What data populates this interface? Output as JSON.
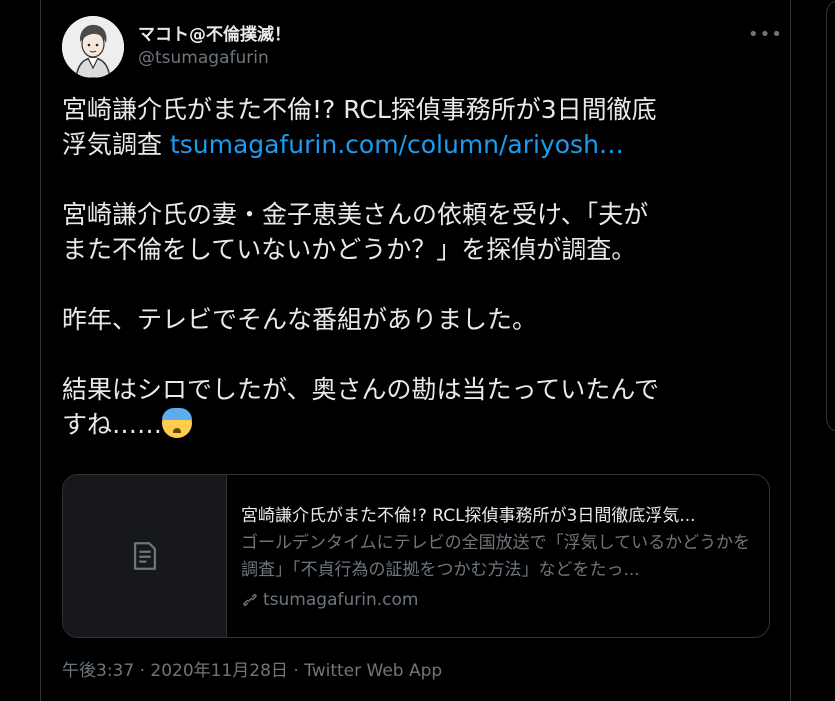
{
  "author": {
    "name": "マコト@不倫撲滅！",
    "handle": "@tsumagafurin"
  },
  "tweet": {
    "line1": "宮崎謙介氏がまた不倫!? RCL探偵事務所が3日間徹底",
    "line2_text": "浮気調査 ",
    "line2_link": "tsumagafurin.com/column/ariyosh…",
    "para2": "宮崎謙介氏の妻・金子恵美さんの依頼を受け、「夫が\nまた不倫をしていないかどうか？」を探偵が調査。",
    "para3": "昨年、テレビでそんな番組がありました。",
    "para4": "結果はシロでしたが、奥さんの勘は当たっていたんで\nすね……"
  },
  "link_card": {
    "title": "宮崎謙介氏がまた不倫!? RCL探偵事務所が3日間徹底浮気...",
    "description": "ゴールデンタイムにテレビの全国放送で「浮気しているかどうかを調査」「不貞行為の証拠をつかむ方法」などをたっ...",
    "domain": "tsumagafurin.com"
  },
  "meta": {
    "timestamp": "午後3:37 · 2020年11月28日 · Twitter Web App"
  },
  "icons": {
    "more": "more-horizontal-icon",
    "article": "article-icon",
    "link": "link-icon",
    "emoji": "anxious-face-emoji"
  },
  "colors": {
    "background": "#000000",
    "text": "#e7e9ea",
    "secondary": "#6e767d",
    "link": "#1d9bf0",
    "border": "#2f3336"
  }
}
